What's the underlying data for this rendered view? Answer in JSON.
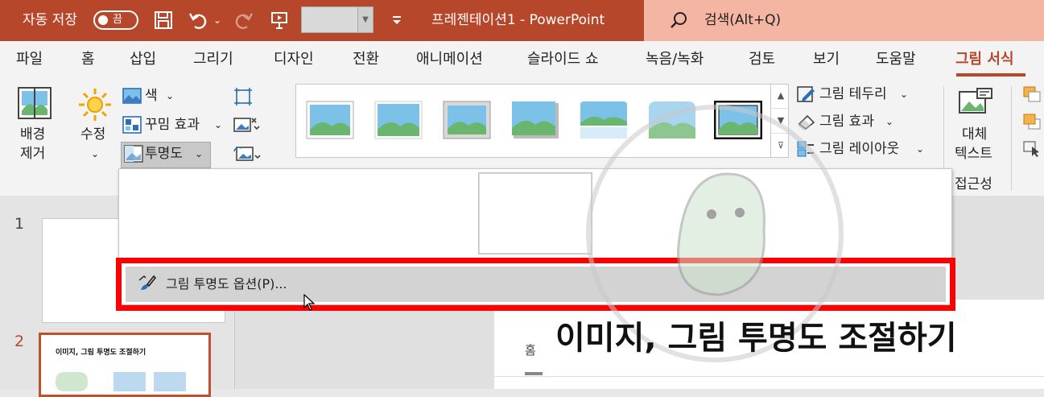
{
  "titlebar": {
    "autosave_label": "자동 저장",
    "autosave_state": "끔",
    "doc_title": "프레젠테이션1  -  PowerPoint",
    "search_placeholder": "검색(Alt+Q)",
    "bg_color": "#b7472a"
  },
  "tabs": [
    {
      "label": "파일"
    },
    {
      "label": "홈"
    },
    {
      "label": "삽입"
    },
    {
      "label": "그리기"
    },
    {
      "label": "디자인"
    },
    {
      "label": "전환"
    },
    {
      "label": "애니메이션"
    },
    {
      "label": "슬라이드 쇼"
    },
    {
      "label": "녹음/녹화"
    },
    {
      "label": "검토"
    },
    {
      "label": "보기"
    },
    {
      "label": "도움말"
    },
    {
      "label": "그림 서식",
      "active": true
    }
  ],
  "ribbon": {
    "remove_bg_line1": "배경",
    "remove_bg_line2": "제거",
    "corrections": "수정",
    "color": "색",
    "artistic_effects": "꾸밈 효과",
    "transparency": "투명도",
    "picture_border": "그림 테두리",
    "picture_effects": "그림 효과",
    "picture_layout": "그림 레이아웃",
    "alt_text_line1": "대체",
    "alt_text_line2": "텍스트",
    "accessibility_group": "접근성"
  },
  "transparency_menu": {
    "option_label": "그림 투명도 옵션(P)..."
  },
  "slides": {
    "slide1_num": "1",
    "slide2_num": "2",
    "slide2_title": "이미지, 그림 투명도 조절하기",
    "slide_tab_label": "홈"
  },
  "overlay_title": "이미지, 그림 투명도 조절하기",
  "colors": {
    "accent": "#b7472a",
    "highlight": "#ff0000",
    "menu_hover": "#d3d3d3"
  }
}
